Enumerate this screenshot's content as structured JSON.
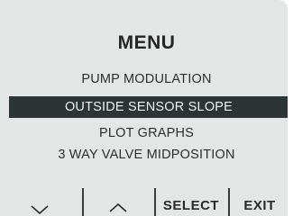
{
  "menu": {
    "title": "MENU",
    "items": [
      {
        "label": "PUMP MODULATION",
        "selected": false
      },
      {
        "label": "OUTSIDE SENSOR SLOPE",
        "selected": true
      },
      {
        "label": "PLOT GRAPHS",
        "selected": false
      },
      {
        "label": "3 WAY VALVE MIDPOSITION",
        "selected": false
      }
    ]
  },
  "softkeys": {
    "down_icon": "chevron-down-icon",
    "up_icon": "chevron-up-icon",
    "select_label": "SELECT",
    "exit_label": "EXIT"
  },
  "colors": {
    "screen_background": "#e4e5e5",
    "highlight_background": "#2d3435",
    "highlight_text": "#f2f2f2",
    "text": "#2b2b2b"
  }
}
